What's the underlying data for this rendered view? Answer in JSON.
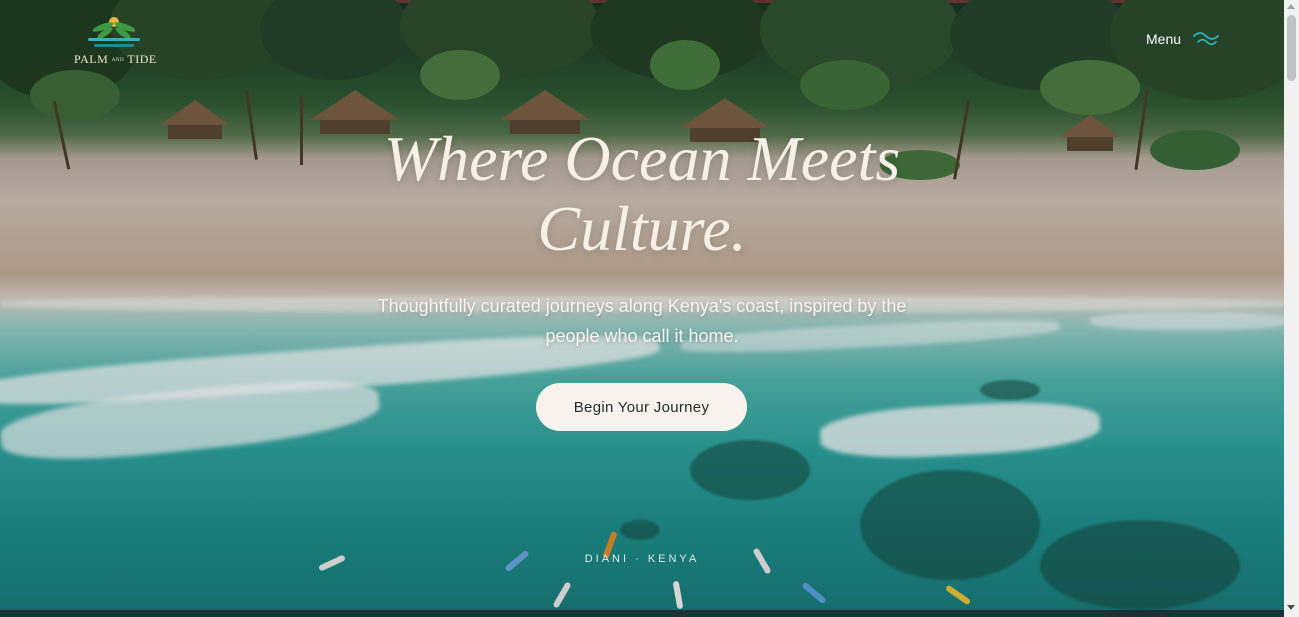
{
  "brand": {
    "name_main_left": "PALM",
    "name_small": "AND",
    "name_main_right": "TIDE",
    "logo_icon": "palm-sun-waves-logo"
  },
  "nav": {
    "menu_label": "Menu",
    "menu_icon": "wave-menu-icon"
  },
  "hero": {
    "headline_line1": "Where Ocean Meets",
    "headline_line2": "Culture.",
    "subtitle": "Thoughtfully curated journeys along Kenya's coast, inspired by the people who call it home.",
    "cta_label": "Begin Your Journey",
    "location": "DIANI · KENYA"
  },
  "colors": {
    "cta_background": "#f7f3ec",
    "headline": "#f6f0e6",
    "menu_icon": "#2fb3c2",
    "logo_gold": "#e8b73b"
  }
}
